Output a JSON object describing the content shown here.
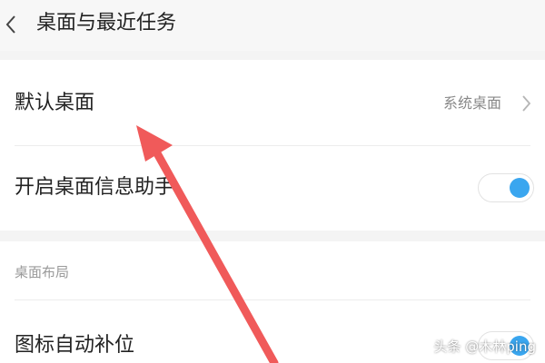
{
  "header": {
    "title": "桌面与最近任务",
    "back_icon": "chevron-left-icon"
  },
  "settings": {
    "default_desktop": {
      "label": "默认桌面",
      "value": "系统桌面"
    },
    "desktop_assistant": {
      "label": "开启桌面信息助手",
      "enabled": true
    }
  },
  "layout_section": {
    "heading": "桌面布局",
    "icon_autofill": {
      "label": "图标自动补位",
      "enabled": true
    }
  },
  "colors": {
    "accent": "#3aa6ef",
    "annotation_arrow": "#f05a5a"
  },
  "watermark": "头条 @木林ping"
}
